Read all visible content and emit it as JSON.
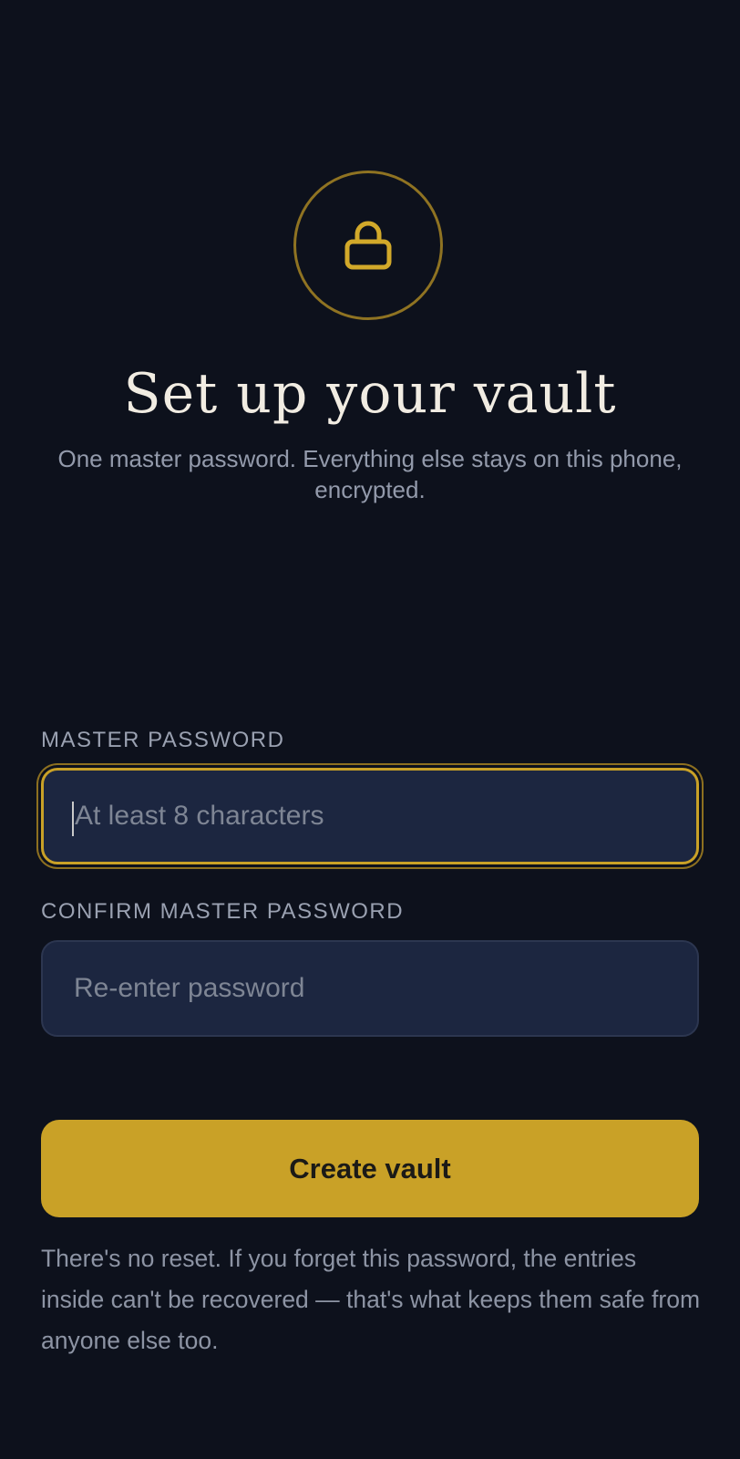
{
  "header": {
    "icon": "lock-icon",
    "title": "Set up your vault",
    "subtitle": "One master password. Everything else stays on this phone, encrypted."
  },
  "form": {
    "master_password": {
      "label": "MASTER PASSWORD",
      "placeholder": "At least 8 characters",
      "value": ""
    },
    "confirm_password": {
      "label": "CONFIRM MASTER PASSWORD",
      "placeholder": "Re-enter password",
      "value": ""
    },
    "submit_label": "Create vault",
    "warning": "There's no reset. If you forget this password, the entries inside can't be recovered — that's what keeps them safe from anyone else too."
  },
  "colors": {
    "background": "#0d111c",
    "accent": "#c9a127",
    "input_bg": "#1c2640",
    "muted_text": "#939aab"
  }
}
